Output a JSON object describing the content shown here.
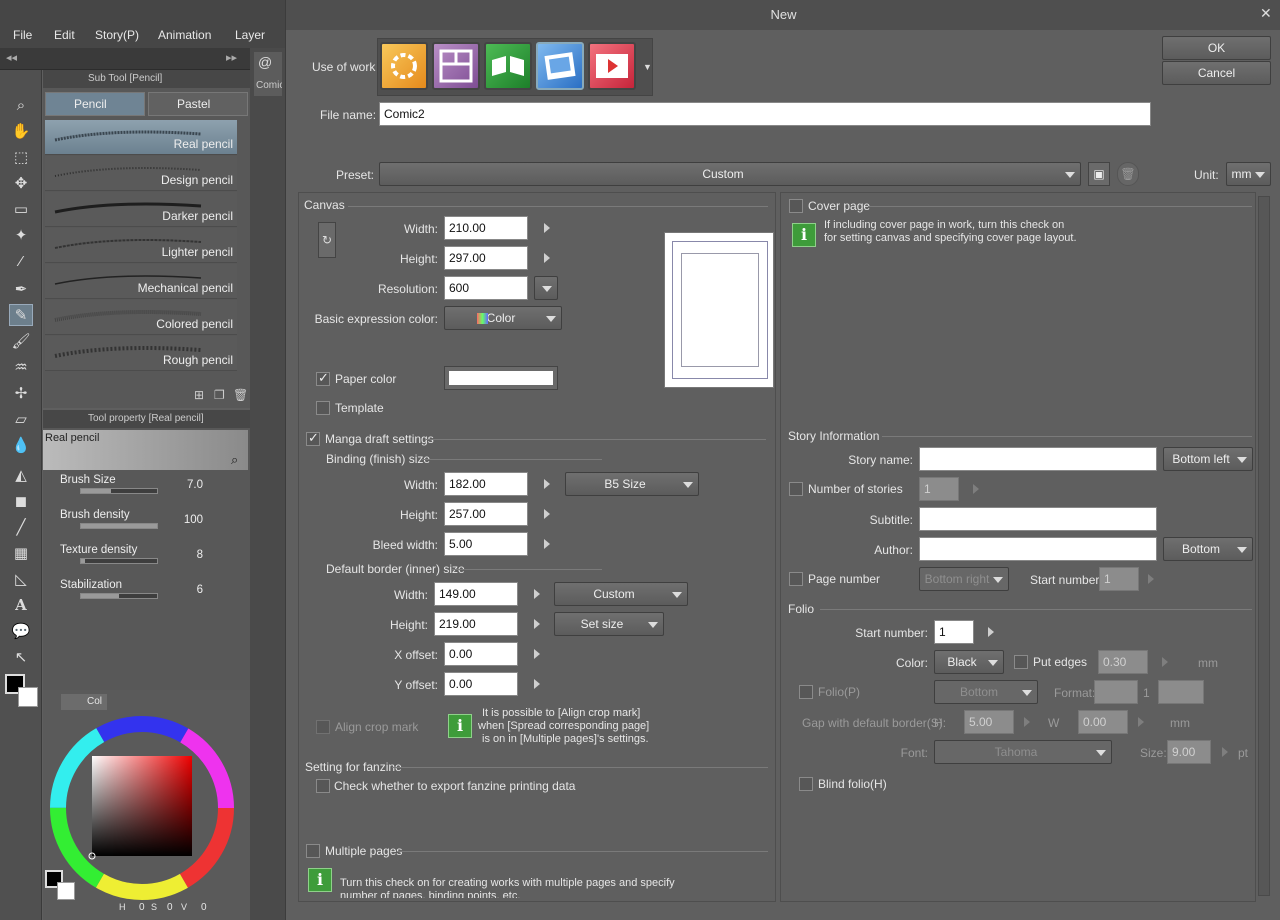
{
  "app": {
    "menu": [
      "File",
      "Edit",
      "Story(P)",
      "Animation",
      "Layer"
    ],
    "subtool_panel_title": "Sub Tool [Pencil]",
    "subtool_tabs": [
      "Pencil",
      "Pastel"
    ],
    "brushes": [
      "Real pencil",
      "Design pencil",
      "Darker pencil",
      "Lighter pencil",
      "Mechanical pencil",
      "Colored pencil",
      "Rough pencil"
    ],
    "toolprop_title": "Tool property [Real pencil]",
    "toolprop_preview": "Real pencil",
    "props": [
      {
        "label": "Brush Size",
        "value": "7.0",
        "level": 0.4
      },
      {
        "label": "Brush density",
        "value": "100",
        "level": 1.0
      },
      {
        "label": "Texture density",
        "value": "8",
        "level": 0.05
      },
      {
        "label": "Stabilization",
        "value": "6",
        "level": 0.5
      }
    ],
    "color_tab": "Col",
    "hsv": {
      "h": "0",
      "s": "0",
      "v": "0",
      "h_label": "H",
      "s_label": "S",
      "v_label": "V"
    },
    "side_tab": "Comic"
  },
  "dialog": {
    "title": "New",
    "use_of_work_label": "Use of work",
    "ok": "OK",
    "cancel": "Cancel",
    "file_name_label": "File name:",
    "file_name": "Comic2",
    "preset_label": "Preset:",
    "preset": "Custom",
    "unit_label": "Unit:",
    "unit": "mm",
    "canvas": {
      "title": "Canvas",
      "width_label": "Width:",
      "width": "210.00",
      "height_label": "Height:",
      "height": "297.00",
      "resolution_label": "Resolution:",
      "resolution": "600",
      "expr_label": "Basic expression color:",
      "expr": "Color",
      "paper_color": "Paper color",
      "template": "Template"
    },
    "manga": {
      "title": "Manga draft settings",
      "binding_title": "Binding (finish) size",
      "b_width_label": "Width:",
      "b_width": "182.00",
      "b_preset": "B5 Size",
      "b_height_label": "Height:",
      "b_height": "257.00",
      "bleed_label": "Bleed width:",
      "bleed": "5.00",
      "border_title": "Default border (inner) size",
      "i_width_label": "Width:",
      "i_width": "149.00",
      "i_preset": "Custom",
      "i_height_label": "Height:",
      "i_height": "219.00",
      "set_size": "Set size",
      "x_label": "X offset:",
      "x": "0.00",
      "y_label": "Y offset:",
      "y": "0.00",
      "align_crop": "Align crop mark",
      "align_info_1": "It is possible to [Align crop mark]",
      "align_info_2": "when [Spread corresponding page]",
      "align_info_3": "is on in [Multiple pages]'s settings."
    },
    "fanzine": {
      "title": "Setting for fanzine",
      "check": "Check whether to export fanzine printing data"
    },
    "multiple": {
      "title": "Multiple pages",
      "info_1": "Turn this check on for creating works with multiple pages and specify",
      "info_2": "number of pages, binding points, etc."
    },
    "cover": {
      "title": "Cover page",
      "info_1": "If including cover page in work, turn this check on",
      "info_2": "for setting canvas and specifying cover page layout."
    },
    "story": {
      "title": "Story Information",
      "name_label": "Story name:",
      "name": "",
      "name_pos": "Bottom left",
      "num_label": "Number of stories",
      "num": "1",
      "subtitle_label": "Subtitle:",
      "subtitle": "",
      "author_label": "Author:",
      "author": "",
      "author_pos": "Bottom",
      "page_num_label": "Page number",
      "page_pos": "Bottom right",
      "start_label": "Start number:",
      "start": "1"
    },
    "folio": {
      "title": "Folio",
      "start_label": "Start number:",
      "start": "1",
      "color_label": "Color:",
      "color": "Black",
      "edges_label": "Put edges",
      "edges": "0.30",
      "edges_unit": "mm",
      "folio_label": "Folio(P)",
      "folio_pos": "Bottom",
      "format_label": "Format:",
      "format_sep": "1",
      "gap_label": "Gap with default border(S):",
      "h_label": "H",
      "h": "5.00",
      "w_label": "W",
      "w": "0.00",
      "gap_unit": "mm",
      "font_label": "Font:",
      "font": "Tahoma",
      "size_label": "Size:",
      "size": "9.00",
      "size_unit": "pt",
      "blind_label": "Blind folio(H)"
    }
  }
}
